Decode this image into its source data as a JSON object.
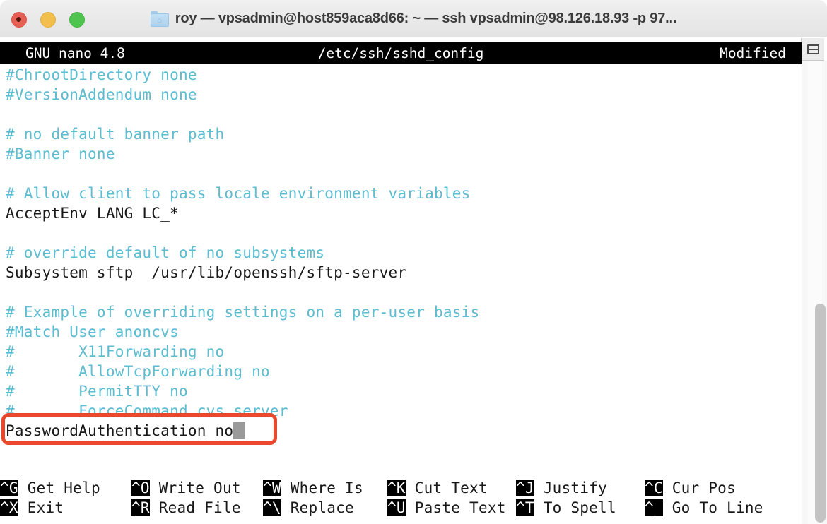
{
  "window": {
    "title": "roy — vpsadmin@host859aca8d66: ~ — ssh vpsadmin@98.126.18.93 -p 97...",
    "folder_icon": "home-folder-icon",
    "traffic_lights": [
      "close-button",
      "minimize-button",
      "zoom-button"
    ],
    "pane_icon": "split-pane-icon"
  },
  "nano": {
    "header": {
      "left": "GNU nano 4.8",
      "center": "/etc/ssh/sshd_config",
      "right": "Modified"
    },
    "lines": [
      {
        "text": "#ChrootDirectory none",
        "kind": "comment"
      },
      {
        "text": "#VersionAddendum none",
        "kind": "comment"
      },
      {
        "text": "",
        "kind": "blank"
      },
      {
        "text": "# no default banner path",
        "kind": "comment"
      },
      {
        "text": "#Banner none",
        "kind": "comment"
      },
      {
        "text": "",
        "kind": "blank"
      },
      {
        "text": "# Allow client to pass locale environment variables",
        "kind": "comment"
      },
      {
        "text": "AcceptEnv LANG LC_*",
        "kind": "code"
      },
      {
        "text": "",
        "kind": "blank"
      },
      {
        "text": "# override default of no subsystems",
        "kind": "comment"
      },
      {
        "text": "Subsystem sftp  /usr/lib/openssh/sftp-server",
        "kind": "code"
      },
      {
        "text": "",
        "kind": "blank"
      },
      {
        "text": "# Example of overriding settings on a per-user basis",
        "kind": "comment"
      },
      {
        "text": "#Match User anoncvs",
        "kind": "comment"
      },
      {
        "text": "#       X11Forwarding no",
        "kind": "comment"
      },
      {
        "text": "#       AllowTcpForwarding no",
        "kind": "comment"
      },
      {
        "text": "#       PermitTTY no",
        "kind": "comment"
      },
      {
        "text": "#       ForceCommand cvs server",
        "kind": "comment"
      },
      {
        "text": "PasswordAuthentication no",
        "kind": "code",
        "cursor_after": true,
        "highlighted": true
      }
    ],
    "shortcuts_row1": [
      {
        "combo": "^G",
        "label": "Get Help"
      },
      {
        "combo": "^O",
        "label": "Write Out"
      },
      {
        "combo": "^W",
        "label": "Where Is"
      },
      {
        "combo": "^K",
        "label": "Cut Text"
      },
      {
        "combo": "^J",
        "label": "Justify"
      },
      {
        "combo": "^C",
        "label": "Cur Pos"
      }
    ],
    "shortcuts_row2": [
      {
        "combo": "^X",
        "label": "Exit"
      },
      {
        "combo": "^R",
        "label": "Read File"
      },
      {
        "combo": "^\\",
        "label": "Replace"
      },
      {
        "combo": "^U",
        "label": "Paste Text"
      },
      {
        "combo": "^T",
        "label": "To Spell"
      },
      {
        "combo": "^_",
        "label": "Go To Line"
      }
    ]
  },
  "annotation": {
    "color": "#E8482C",
    "target_line": "PasswordAuthentication no"
  },
  "colors": {
    "comment": "#5CBCD0",
    "code": "#181818",
    "header_bg": "#000000",
    "header_fg": "#FFFFFF",
    "cursor": "#9A9A9A",
    "annotation": "#E8482C"
  },
  "scrollbar": {
    "name": "vertical-scrollbar"
  }
}
